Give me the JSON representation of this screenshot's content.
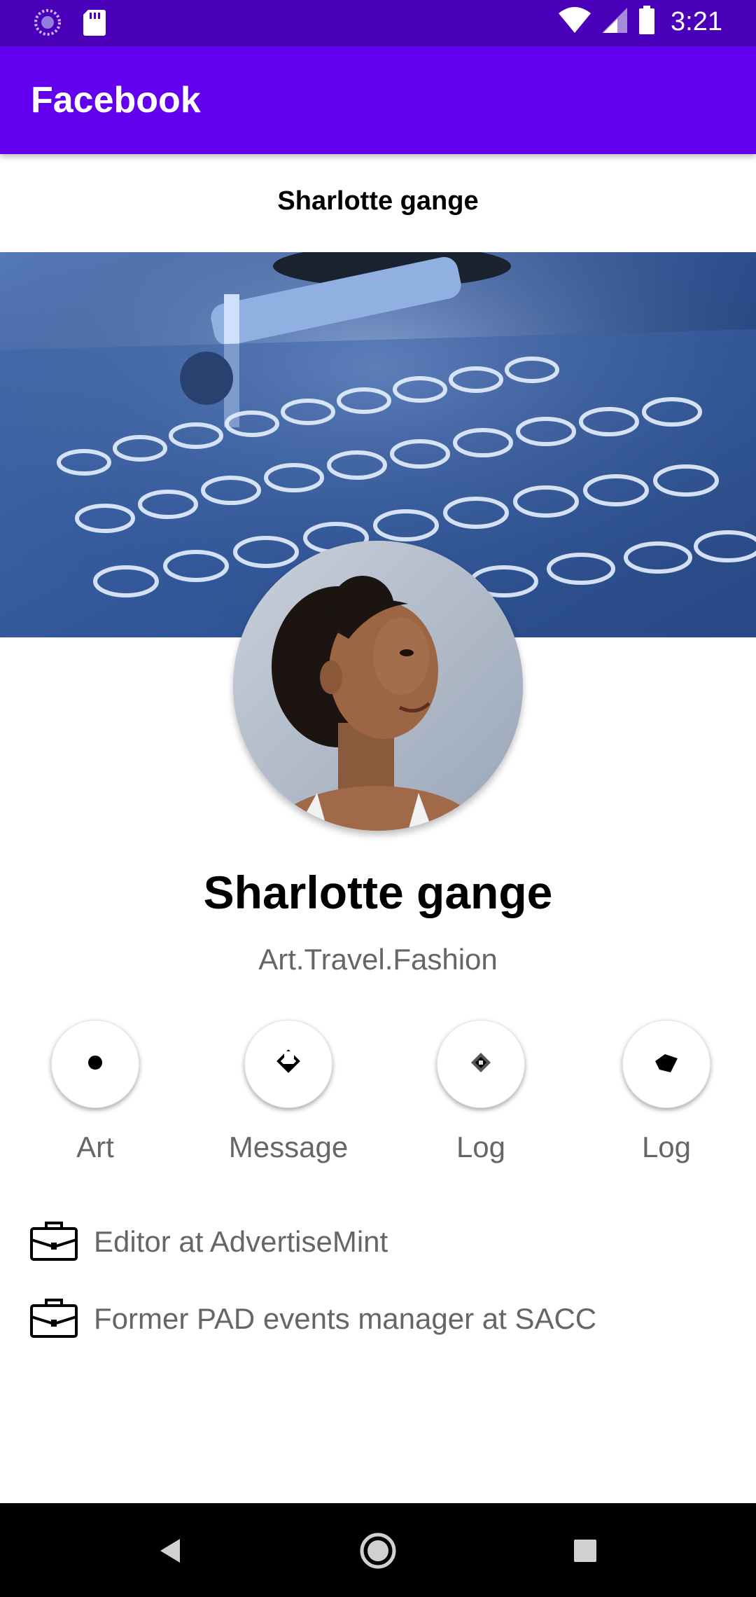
{
  "status_bar": {
    "time": "3:21",
    "left_icons": [
      "spinner-icon",
      "sd-card-icon"
    ],
    "right_icons": [
      "wifi-icon",
      "signal-icon",
      "battery-icon"
    ]
  },
  "app_bar": {
    "title": "Facebook",
    "color": "#6200ee"
  },
  "profile": {
    "header_name": "Sharlotte gange",
    "name": "Sharlotte gange",
    "tagline": "Art.Travel.Fashion",
    "cover_image": "lab-test-tubes-photo",
    "avatar_image": "girl-portrait-photo"
  },
  "actions": [
    {
      "label": "Art",
      "icon": "dot-icon"
    },
    {
      "label": "Message",
      "icon": "message-diamond-icon"
    },
    {
      "label": "Log",
      "icon": "diamond-icon"
    },
    {
      "label": "Log",
      "icon": "tag-icon"
    }
  ],
  "info": [
    {
      "text": "Editor at AdvertiseMint",
      "icon": "briefcase-icon"
    },
    {
      "text": "Former PAD events manager at SACC",
      "icon": "briefcase-icon"
    }
  ],
  "nav_bar": {
    "buttons": [
      "back-icon",
      "home-icon",
      "recents-icon"
    ]
  }
}
